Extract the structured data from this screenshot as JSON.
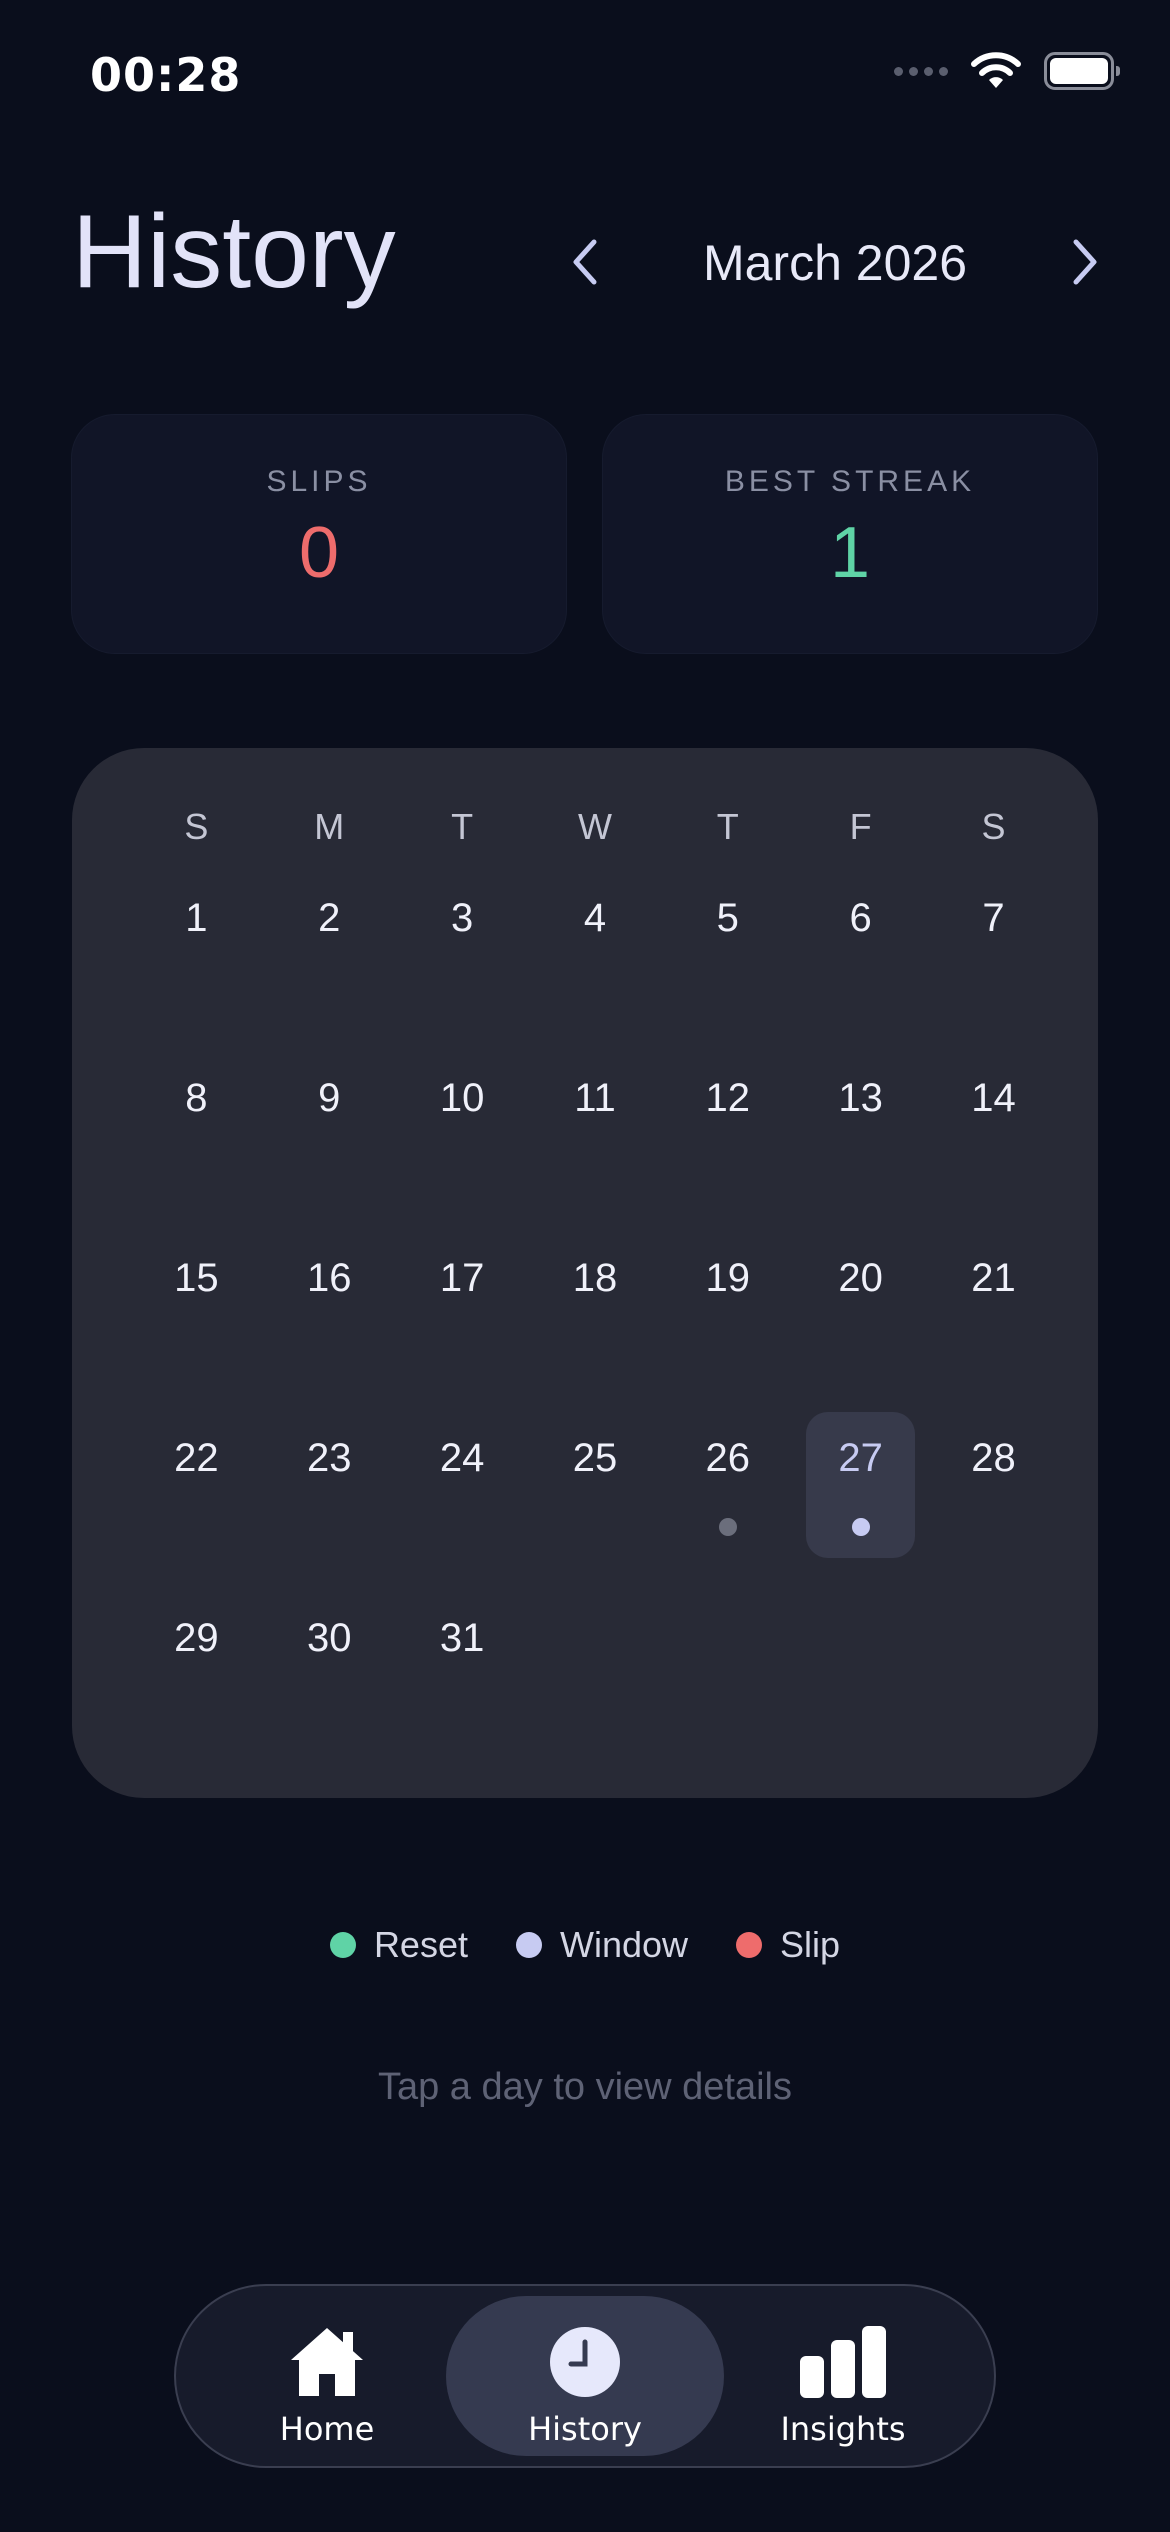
{
  "status_bar": {
    "time": "00:28"
  },
  "header": {
    "title": "History",
    "month": "March 2026"
  },
  "stats": {
    "slips": {
      "label": "SLIPS",
      "value": "0"
    },
    "best_streak": {
      "label": "BEST STREAK",
      "value": "1"
    }
  },
  "calendar": {
    "weekdays": [
      "S",
      "M",
      "T",
      "W",
      "T",
      "F",
      "S"
    ],
    "weeks": [
      [
        "1",
        "2",
        "3",
        "4",
        "5",
        "6",
        "7"
      ],
      [
        "8",
        "9",
        "10",
        "11",
        "12",
        "13",
        "14"
      ],
      [
        "15",
        "16",
        "17",
        "18",
        "19",
        "20",
        "21"
      ],
      [
        "22",
        "23",
        "24",
        "25",
        "26",
        "27",
        "28"
      ],
      [
        "29",
        "30",
        "31",
        "",
        "",
        "",
        ""
      ]
    ],
    "selected_day": "27",
    "markers": {
      "26": "gray",
      "27": "window"
    }
  },
  "legend": [
    {
      "label": "Reset",
      "color": "#5fd3a6"
    },
    {
      "label": "Window",
      "color": "#c7cbf2"
    },
    {
      "label": "Slip",
      "color": "#ee6c6c"
    }
  ],
  "hint": "Tap a day to view details",
  "tabs": [
    {
      "label": "Home",
      "icon": "house-icon"
    },
    {
      "label": "History",
      "icon": "clock-icon",
      "active": true
    },
    {
      "label": "Insights",
      "icon": "bar-chart-icon"
    }
  ],
  "colors": {
    "background": "#0a0e1c",
    "calendar_bg": "#282a36",
    "marker_gray": "#6b6e7c",
    "marker_window": "#c7cbf2"
  }
}
